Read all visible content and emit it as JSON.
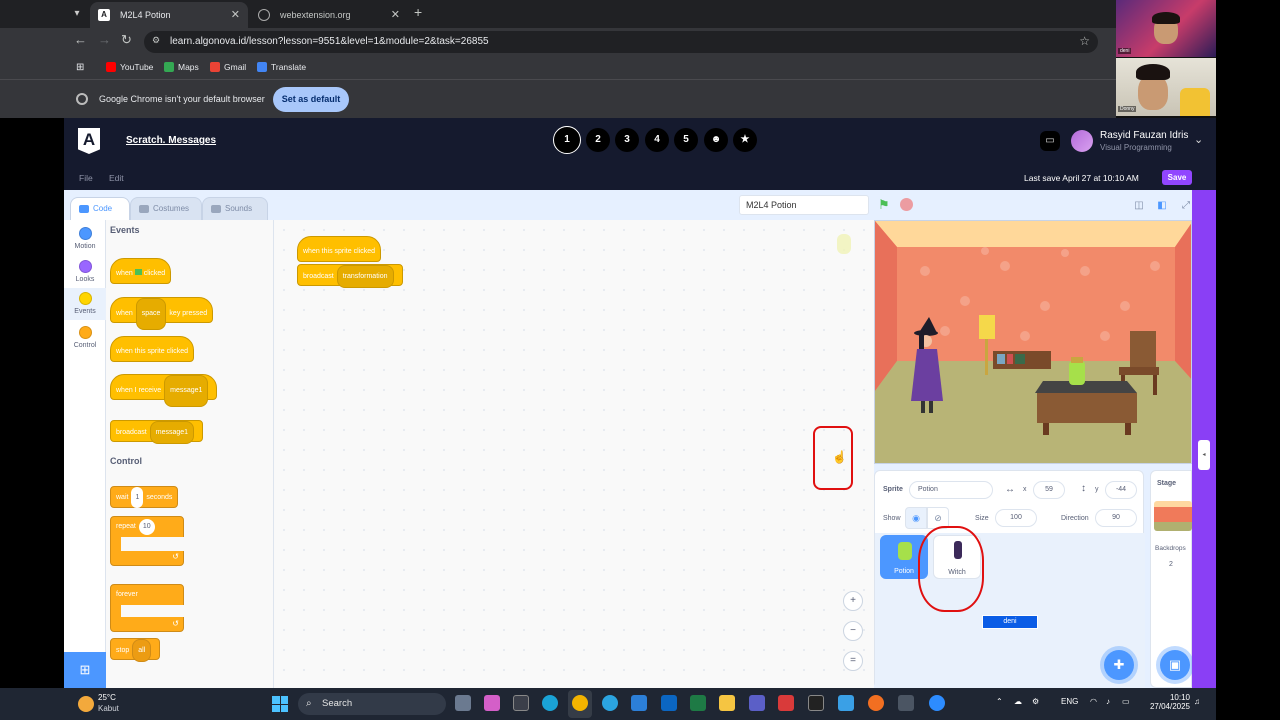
{
  "browser": {
    "tabs": [
      {
        "title": "M2L4 Potion",
        "active": true
      },
      {
        "title": "webextension.org",
        "active": false
      }
    ],
    "url": "learn.algonova.id/lesson?lesson=9551&level=1&module=2&task=26855",
    "bookmarks": [
      "YouTube",
      "Maps",
      "Gmail",
      "Translate"
    ],
    "infobar_message": "Google Chrome isn't your default browser",
    "infobar_button": "Set as default"
  },
  "webcam": {
    "top_label": "deni",
    "bottom_label": "Donny"
  },
  "app": {
    "lesson_title": "Scratch. Messages",
    "steps": [
      "1",
      "2",
      "3",
      "4",
      "5",
      "☻",
      "★"
    ],
    "current_step": 1,
    "user_name": "Rasyid Fauzan Idris",
    "user_role": "Visual Programming",
    "menu": [
      "File",
      "Edit"
    ],
    "last_save": "Last save April 27 at 10:10 AM",
    "save_label": "Save"
  },
  "editor": {
    "tabs": [
      "Code",
      "Costumes",
      "Sounds"
    ],
    "categories": [
      {
        "label": "Motion",
        "color": "#4c97ff"
      },
      {
        "label": "Looks",
        "color": "#9966ff"
      },
      {
        "label": "Events",
        "color": "#ffd500"
      },
      {
        "label": "Control",
        "color": "#ffab19"
      }
    ],
    "palette": {
      "events_heading": "Events",
      "control_heading": "Control",
      "when_flag": {
        "a": "when",
        "b": "clicked"
      },
      "when_key": {
        "a": "when",
        "key": "space",
        "b": "key pressed"
      },
      "when_sprite_clicked": "when this sprite clicked",
      "when_receive": {
        "a": "when I receive",
        "msg": "message1"
      },
      "broadcast": {
        "a": "broadcast",
        "msg": "message1"
      },
      "wait": {
        "a": "wait",
        "n": "1",
        "b": "seconds"
      },
      "repeat": {
        "a": "repeat",
        "n": "10"
      },
      "forever": "forever",
      "stop": {
        "a": "stop",
        "opt": "all"
      }
    },
    "script": {
      "hat": "when this sprite clicked",
      "broadcast": "broadcast",
      "message": "transformation"
    },
    "project_name": "M2L4 Potion",
    "sprite_info": {
      "sprite_label": "Sprite",
      "sprite_name": "Potion",
      "x_label": "x",
      "x": "59",
      "y_label": "y",
      "y": "-44",
      "show_label": "Show",
      "size_label": "Size",
      "size": "100",
      "direction_label": "Direction",
      "direction": "90"
    },
    "sprites": [
      "Potion",
      "Witch"
    ],
    "selected_sprite": "Potion",
    "overlay_label": "deni",
    "stage_panel": {
      "title": "Stage",
      "backdrops_label": "Backdrops",
      "backdrops_count": "2"
    }
  },
  "taskbar": {
    "temperature": "25°C",
    "weather": "Kabut",
    "search_placeholder": "Search",
    "language": "ENG",
    "time": "10:10",
    "date": "27/04/2025"
  },
  "colors": {
    "app_header": "#151a2e",
    "scratch_blue": "#4c97ff",
    "events_yellow": "#ffbf00",
    "control_orange": "#ffab19",
    "accent_purple": "#9146ff",
    "annotation_red": "#e01010"
  }
}
